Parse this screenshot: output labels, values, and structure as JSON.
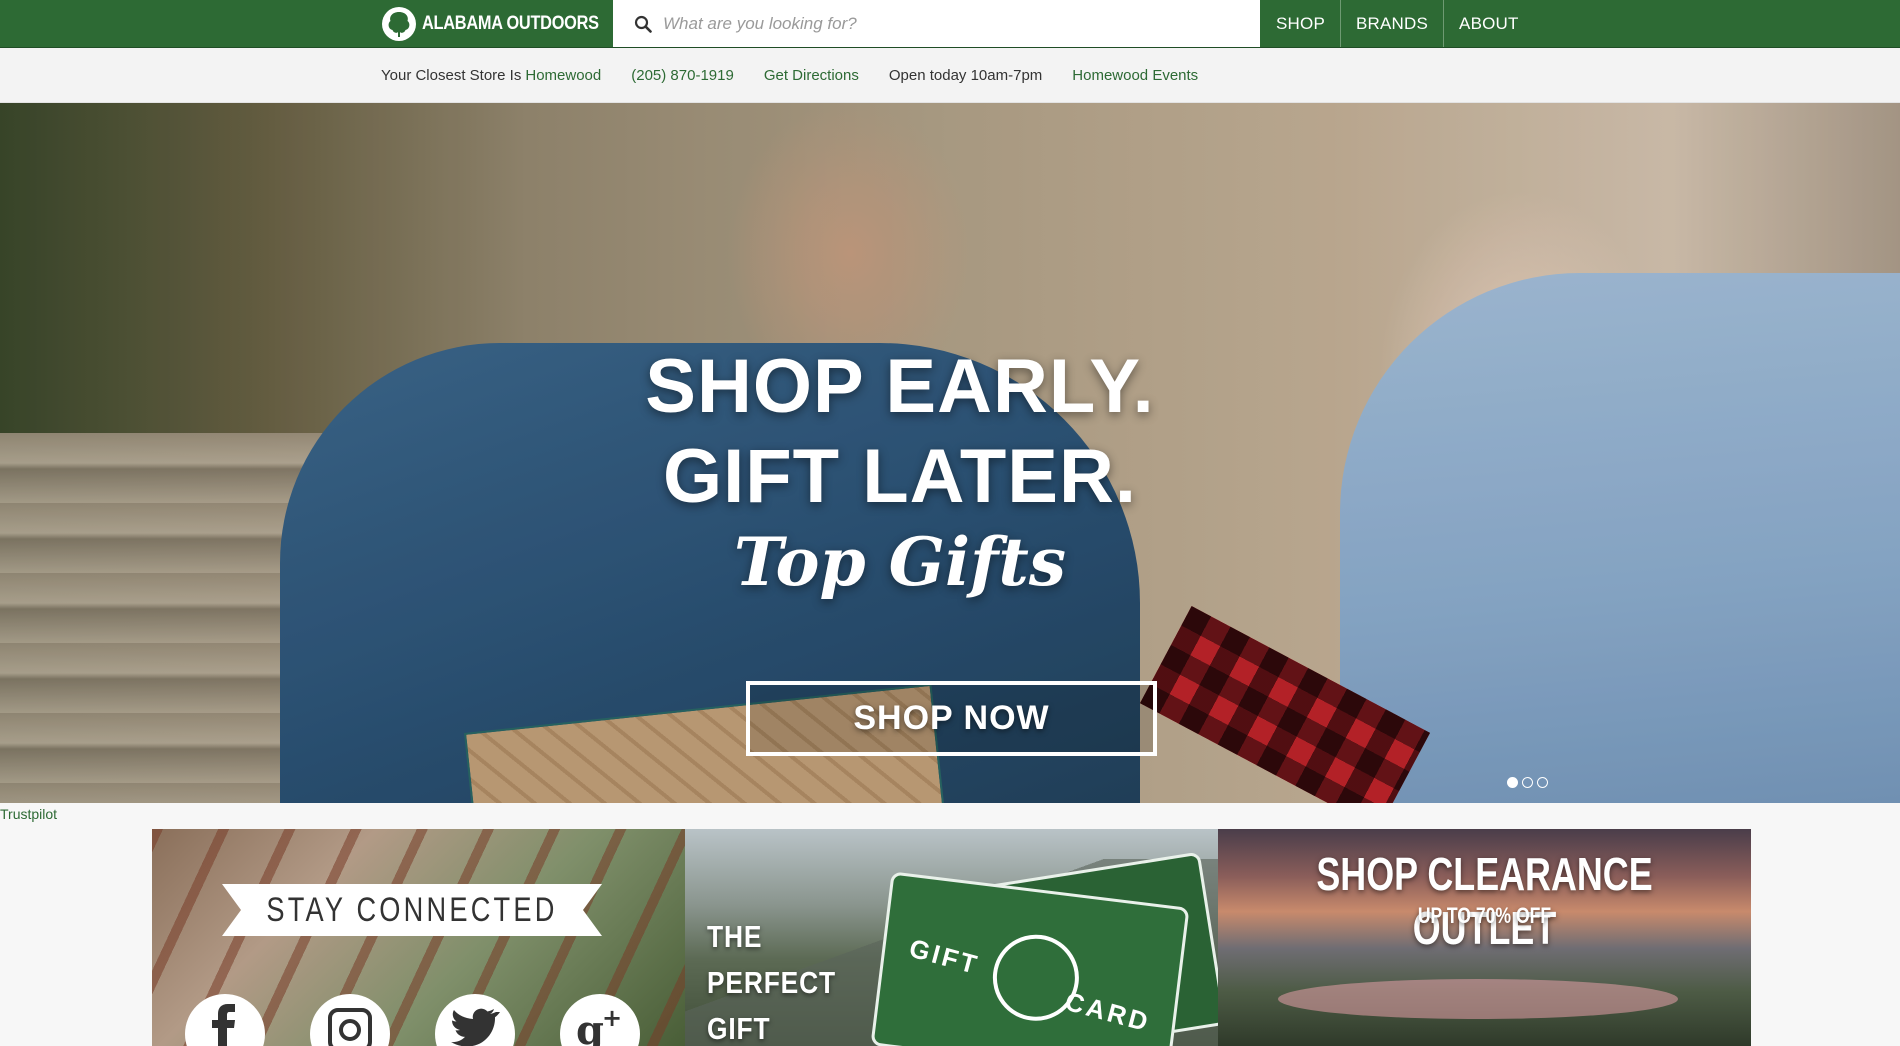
{
  "header": {
    "logo_text": "ALABAMA OUTDOORS",
    "search": {
      "placeholder": "What are you looking for?"
    },
    "nav": [
      {
        "label": "SHOP"
      },
      {
        "label": "BRANDS"
      },
      {
        "label": "ABOUT"
      }
    ]
  },
  "store_bar": {
    "closest_prefix": "Your Closest Store Is",
    "store_name": "Homewood",
    "phone": "(205) 870-1919",
    "directions": "Get Directions",
    "hours": "Open today 10am-7pm",
    "events": "Homewood Events"
  },
  "hero": {
    "line1": "SHOP EARLY.",
    "line2": "GIFT LATER.",
    "script": "Top Gifts",
    "cta": "SHOP NOW",
    "slides_total": 3,
    "active_slide": 1
  },
  "trustpilot": "Trustpilot",
  "tiles": {
    "stay_connected": {
      "title": "STAY CONNECTED",
      "icons": [
        "facebook-icon",
        "instagram-icon",
        "twitter-icon",
        "google-plus-icon"
      ]
    },
    "gift_card": {
      "line1": "THE",
      "line2": "PERFECT",
      "line3": "GIFT",
      "card_left": "GIFT",
      "card_right": "CARD"
    },
    "clearance": {
      "title": "SHOP CLEARANCE OUTLET",
      "subtitle": "UP TO 70% OFF"
    }
  },
  "colors": {
    "brand_green": "#2d6a34",
    "link_green": "#2d6a34",
    "white": "#ffffff"
  }
}
